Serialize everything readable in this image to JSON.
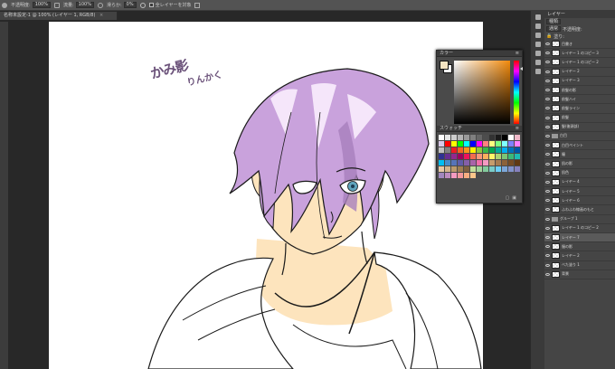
{
  "options_bar": {
    "mode_label": "不透明度:",
    "opacity_value": "100%",
    "flow_label": "流量:",
    "flow_value": "100%",
    "smooth_label": "滑らか:",
    "smooth_value": "0%",
    "sample_label": "全レイヤーを対象"
  },
  "document_tab": {
    "title": "名称未設定-1 @ 100% (レイヤー 1, RGB/8)",
    "close": "×"
  },
  "canvas": {
    "signature_main": "かみ影",
    "signature_sub": "りんかく"
  },
  "color_panel": {
    "title": "カラー",
    "swatches_title": "スウォッチ",
    "fg_color": "#f4e4c2",
    "bg_color": "#ffffff",
    "hue_color": "#f28a0c",
    "swatch_colors": [
      "#ffffff",
      "#e6e6e6",
      "#cccccc",
      "#b3b3b3",
      "#999999",
      "#808080",
      "#666666",
      "#4d4d4d",
      "#333333",
      "#1a1a1a",
      "#000000",
      "#ffffff",
      "#f0b8c8",
      "#d8c8e8",
      "#ff0000",
      "#ffff00",
      "#00ff00",
      "#00ffff",
      "#0000ff",
      "#ff00ff",
      "#ff8080",
      "#ffff80",
      "#80ff80",
      "#80ffff",
      "#8080ff",
      "#ff80ff",
      "#c0c0c0",
      "#808080",
      "#ed1c24",
      "#f26522",
      "#f7941d",
      "#fff200",
      "#8dc63f",
      "#39b54a",
      "#00a651",
      "#00a99d",
      "#00aeef",
      "#0072bc",
      "#0054a6",
      "#2e3192",
      "#662d91",
      "#92278f",
      "#9e005d",
      "#ed145b",
      "#f26c4f",
      "#f69679",
      "#fbaf5d",
      "#fff568",
      "#acd373",
      "#7cc576",
      "#3cb878",
      "#1cbbb4",
      "#00bff3",
      "#448ccb",
      "#5674b9",
      "#605ca8",
      "#855fa8",
      "#a864a8",
      "#f06eaa",
      "#f49ac2",
      "#c69c6d",
      "#a67c52",
      "#8c6239",
      "#754c24",
      "#603913",
      "#e5c9a6",
      "#d2b48c",
      "#bc9a6c",
      "#9e7e52",
      "#7f6040",
      "#c4df9b",
      "#a3d39c",
      "#82ca9c",
      "#7accc8",
      "#6dcff6",
      "#7da7d9",
      "#8393ca",
      "#8781bd",
      "#a187be",
      "#bd8cbf",
      "#f49ac1",
      "#f5989d",
      "#f9ad81",
      "#fdc68a"
    ],
    "footer_icons": [
      "new-swatch-icon",
      "delete-swatch-icon"
    ]
  },
  "layers_panel": {
    "tab_label": "レイヤー",
    "kind_label": "種類",
    "blend_mode": "通常",
    "opacity_label": "不透明度:",
    "fill_label": "塗り:",
    "layers": [
      {
        "name": "目書き",
        "type": "layer",
        "selected": false
      },
      {
        "name": "レイヤー 1 のコピー 3",
        "type": "layer",
        "selected": false
      },
      {
        "name": "レイヤー 1 のコピー 2",
        "type": "layer",
        "selected": false
      },
      {
        "name": "レイヤー 2",
        "type": "layer",
        "selected": false
      },
      {
        "name": "レイヤー 3",
        "type": "layer",
        "selected": false
      },
      {
        "name": "前髪の影",
        "type": "layer",
        "selected": false
      },
      {
        "name": "前髪ハイ",
        "type": "layer",
        "selected": false
      },
      {
        "name": "前髪ライン",
        "type": "layer",
        "selected": false
      },
      {
        "name": "前髪",
        "type": "layer",
        "selected": false
      },
      {
        "name": "髪(後頭部)",
        "type": "layer",
        "selected": false
      },
      {
        "name": "白目",
        "type": "folder",
        "selected": false
      },
      {
        "name": "白目ペイント",
        "type": "layer",
        "selected": false
      },
      {
        "name": "瞳",
        "type": "layer",
        "selected": false
      },
      {
        "name": "肌の影",
        "type": "layer",
        "selected": false
      },
      {
        "name": "肌色",
        "type": "layer",
        "selected": false
      },
      {
        "name": "レイヤー 4",
        "type": "layer",
        "selected": false
      },
      {
        "name": "レイヤー 5",
        "type": "layer",
        "selected": false
      },
      {
        "name": "レイヤー 6",
        "type": "layer",
        "selected": false
      },
      {
        "name": "ふわふわ線画のもと",
        "type": "layer",
        "selected": false
      },
      {
        "name": "グループ 1",
        "type": "folder",
        "selected": false
      },
      {
        "name": "レイヤー 1 のコピー 2",
        "type": "layer",
        "selected": false
      },
      {
        "name": "レイヤー 7",
        "type": "layer",
        "selected": true
      },
      {
        "name": "服の影",
        "type": "layer",
        "selected": false
      },
      {
        "name": "レイヤー 2",
        "type": "layer",
        "selected": false
      },
      {
        "name": "べた塗り 1",
        "type": "layer",
        "selected": false
      },
      {
        "name": "背景",
        "type": "layer",
        "selected": false
      }
    ]
  }
}
